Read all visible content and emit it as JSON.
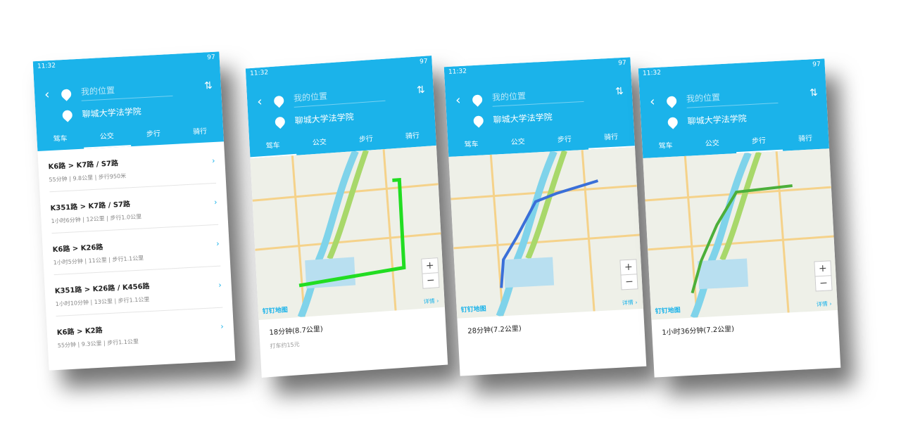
{
  "status": {
    "time": "11:32",
    "battery": "97"
  },
  "header": {
    "origin_placeholder": "我的位置",
    "destination": "聊城大学法学院"
  },
  "tabs": [
    "驾车",
    "公交",
    "步行",
    "骑行"
  ],
  "screen1": {
    "active_tab": 1,
    "routes": [
      {
        "title": "K6路 > K7路 / S7路",
        "meta": "55分钟 | 9.8公里 | 步行950米"
      },
      {
        "title": "K351路 > K7路 / S7路",
        "meta": "1小时6分钟 | 12公里 | 步行1.0公里"
      },
      {
        "title": "K6路 > K26路",
        "meta": "1小时5分钟 | 11公里 | 步行1.1公里"
      },
      {
        "title": "K351路 > K26路 / K456路",
        "meta": "1小时10分钟 | 13公里 | 步行1.1公里"
      },
      {
        "title": "K6路 > K2路",
        "meta": "55分钟 | 9.3公里 | 步行1.1公里"
      }
    ]
  },
  "map_common": {
    "logo": "钉钉地图",
    "detail": "详情 ›",
    "zoom_in": "+",
    "zoom_out": "−"
  },
  "screen2": {
    "active_tab": 0,
    "duration": "18分钟(8.7公里)",
    "taxi": "打车约15元",
    "route_color": "#22dd22"
  },
  "screen3": {
    "active_tab": 3,
    "duration": "28分钟(7.2公里)",
    "route_color": "#3a6fd8"
  },
  "screen4": {
    "active_tab": 2,
    "duration": "1小时36分钟(7.2公里)",
    "route_color": "#4caf3a"
  },
  "colors": {
    "accent": "#1bb3ea",
    "river": "#7fd3ea",
    "park": "#a8d86a"
  }
}
